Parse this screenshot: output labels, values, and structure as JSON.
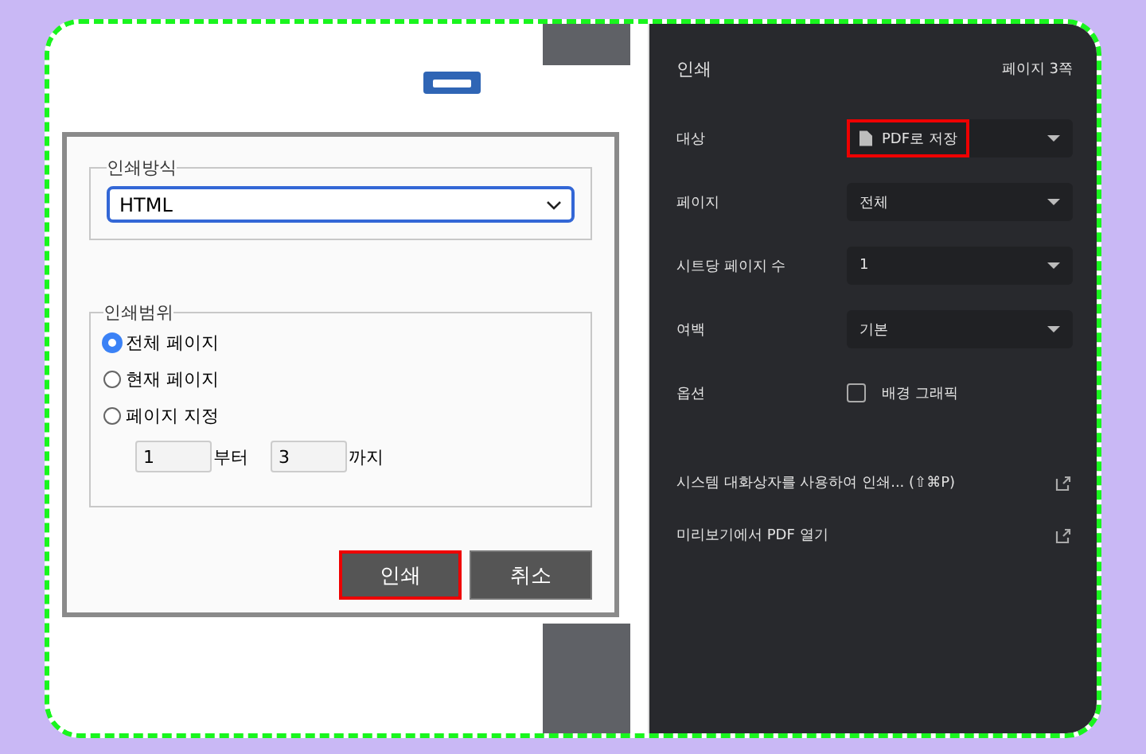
{
  "dialog": {
    "print_method": {
      "legend": "인쇄방식",
      "value": "HTML"
    },
    "print_range": {
      "legend": "인쇄범위",
      "options": [
        {
          "label": "전체 페이지",
          "selected": true
        },
        {
          "label": "현재 페이지",
          "selected": false
        },
        {
          "label": "페이지 지정",
          "selected": false
        }
      ],
      "from": {
        "value": "1",
        "suffix": "부터"
      },
      "to": {
        "value": "3",
        "suffix": "까지"
      }
    },
    "buttons": [
      {
        "label": "인쇄",
        "highlighted": true
      },
      {
        "label": "취소",
        "highlighted": false
      }
    ]
  },
  "print_panel": {
    "title": "인쇄",
    "page_count": "페이지 3쪽",
    "settings": [
      {
        "kind": "destination",
        "label": "대상",
        "value": "PDF로 저장",
        "highlighted": true
      },
      {
        "kind": "select",
        "label": "페이지",
        "value": "전체",
        "highlighted": false
      },
      {
        "kind": "select",
        "label": "시트당 페이지 수",
        "value": "1",
        "highlighted": false
      },
      {
        "kind": "select",
        "label": "여백",
        "value": "기본",
        "highlighted": false
      },
      {
        "kind": "checkbox",
        "label": "옵션",
        "value": "배경 그래픽",
        "checked": false
      }
    ],
    "links": [
      {
        "label": "시스템 대화상자를 사용하여 인쇄... (⇧⌘P)"
      },
      {
        "label": "미리보기에서 PDF 열기"
      }
    ]
  }
}
